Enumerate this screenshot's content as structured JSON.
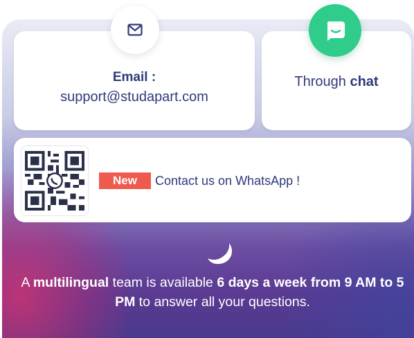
{
  "email": {
    "title": "Email :",
    "address": "support@studapart.com",
    "icon": "mail-icon"
  },
  "chat": {
    "text_prefix": "Through ",
    "text_bold": "chat",
    "icon": "chat-bubble-icon",
    "icon_color": "#2fcc8b"
  },
  "whatsapp": {
    "badge": "New",
    "badge_color": "#ee5a4d",
    "text": "Contact us on WhatsApp !",
    "qr_icon": "qr-code-icon",
    "whatsapp_icon": "whatsapp-icon"
  },
  "footer": {
    "part1": "A ",
    "bold1": "multilingual",
    "part2": " team is available ",
    "bold2": "6 days a week from 9 AM to 5 PM",
    "part3": " to answer all your questions."
  },
  "colors": {
    "text_primary": "#2f3a7a",
    "accent_green": "#2fcc8b",
    "accent_red": "#ee5a4d"
  }
}
